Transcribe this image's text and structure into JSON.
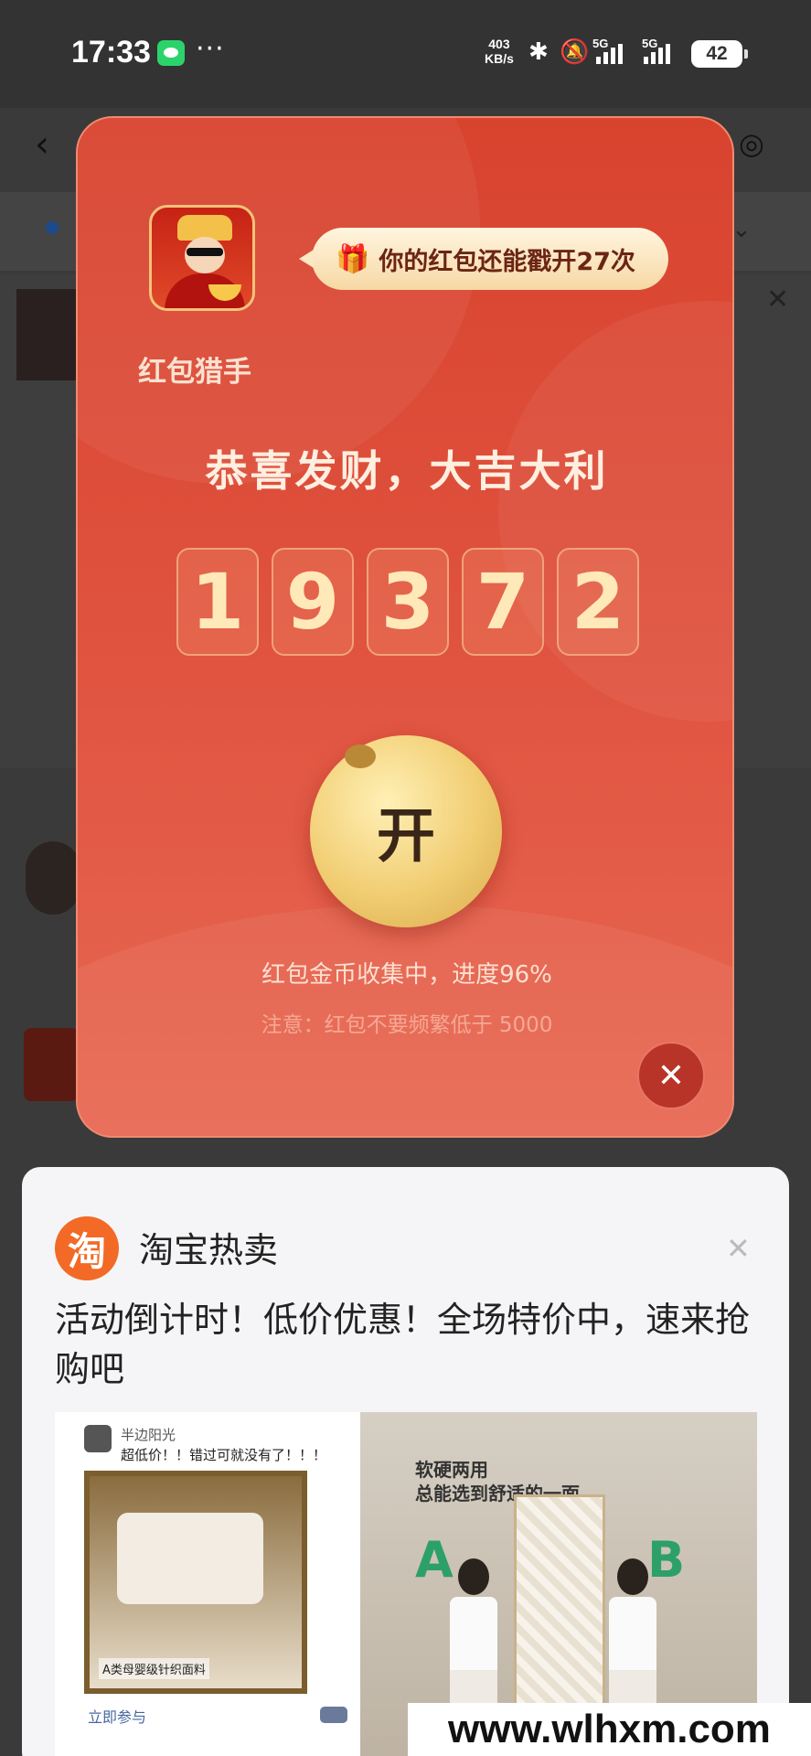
{
  "status_bar": {
    "time": "17:33",
    "more": "···",
    "net_speed_value": "403",
    "net_speed_unit": "KB/s",
    "signal1_label": "5G",
    "signal2_label": "5G",
    "battery": "42"
  },
  "red_packet": {
    "app_name": "红包猎手",
    "bubble_text": "你的红包还能戳开27次",
    "congrats": "恭喜发财，大吉大利",
    "digits": [
      "1",
      "9",
      "3",
      "7",
      "2"
    ],
    "open_label": "开",
    "progress_text": "红包金币收集中，进度96%",
    "progress_value": 96,
    "note_text": "注意：红包不要频繁低于 5000",
    "close_symbol": "✕"
  },
  "ad_card": {
    "brand_logo_char": "淘",
    "brand_name": "淘宝热卖",
    "close_symbol": "✕",
    "text": "活动倒计时！低价优惠！全场特价中，速来抢购吧",
    "left_image": {
      "user": "半边阳光",
      "message": "超低价！！错过可就没有了！！！",
      "caption": "A类母婴级针织面料",
      "join_label": "立即参与"
    },
    "right_image": {
      "title_line1": "软硬两用",
      "title_line2": "总能选到舒适的一面",
      "label_a": "A",
      "label_b": "B"
    }
  },
  "watermark": "www.wlhxm.com",
  "colors": {
    "packet_red": "#d8432e",
    "gold": "#f1cd72",
    "taobao_orange": "#f26a26"
  }
}
